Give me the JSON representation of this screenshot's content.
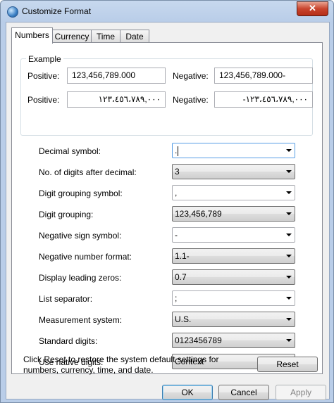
{
  "window": {
    "title": "Customize Format",
    "close_label": "✕"
  },
  "tabs": [
    {
      "label": "Numbers"
    },
    {
      "label": "Currency"
    },
    {
      "label": "Time"
    },
    {
      "label": "Date"
    }
  ],
  "example": {
    "group_label": "Example",
    "positive_label": "Positive:",
    "negative_label": "Negative:",
    "positive_value_1": "123,456,789.000",
    "negative_value_1": "123,456,789.000-",
    "positive_value_2": "١٢٣،٤٥٦،٧٨٩,٠٠٠",
    "negative_value_2": "-١٢٣،٤٥٦،٧٨٩,٠٠٠"
  },
  "settings": [
    {
      "label": "Decimal symbol:",
      "value": "."
    },
    {
      "label": "No. of digits after decimal:",
      "value": "3"
    },
    {
      "label": "Digit grouping symbol:",
      "value": ","
    },
    {
      "label": "Digit grouping:",
      "value": "123,456,789"
    },
    {
      "label": "Negative sign symbol:",
      "value": "-"
    },
    {
      "label": "Negative number format:",
      "value": "1.1-"
    },
    {
      "label": "Display leading zeros:",
      "value": "0.7"
    },
    {
      "label": "List separator:",
      "value": ";"
    },
    {
      "label": "Measurement system:",
      "value": "U.S."
    },
    {
      "label": "Standard digits:",
      "value": "0123456789"
    },
    {
      "label": "Use native digits:",
      "value": "Context"
    }
  ],
  "footer": {
    "reset_text": "Click Reset to restore the system default settings for numbers, currency, time, and date.",
    "reset_button": "Reset"
  },
  "buttons": {
    "ok": "OK",
    "cancel": "Cancel",
    "apply": "Apply"
  }
}
